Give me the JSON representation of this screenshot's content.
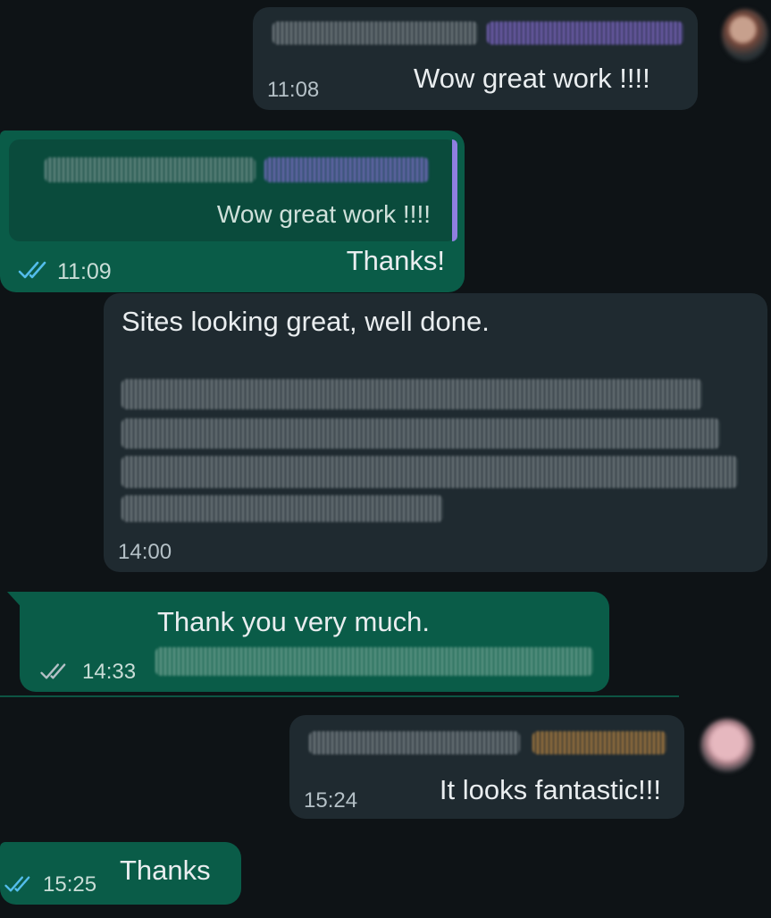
{
  "messages": [
    {
      "id": "m1",
      "direction": "incoming",
      "text": "Wow great work !!!!",
      "time": "11:08"
    },
    {
      "id": "m2",
      "direction": "outgoing",
      "quoted_text": "Wow great work !!!!",
      "text": "Thanks!",
      "time": "11:09",
      "status": "read"
    },
    {
      "id": "m3",
      "direction": "incoming",
      "text": "Sites looking great, well done.",
      "time": "14:00"
    },
    {
      "id": "m4",
      "direction": "outgoing",
      "text": "Thank you very much.",
      "time": "14:33",
      "status": "delivered"
    },
    {
      "id": "m5",
      "direction": "incoming",
      "text": "It looks fantastic!!!",
      "time": "15:24"
    },
    {
      "id": "m6",
      "direction": "outgoing",
      "text": "Thanks",
      "time": "15:25",
      "status": "read"
    }
  ],
  "icons": {
    "read_ticks": "double-check-blue-icon",
    "delivered_ticks": "double-check-grey-icon",
    "avatar": "avatar"
  },
  "colors": {
    "background": "#0e1316",
    "incoming_bubble": "#1f2a30",
    "outgoing_bubble": "#0a5c48",
    "read_tick": "#53bdeb",
    "delivered_tick": "#b4c0c6",
    "quote_bar": "#8f7fe0"
  }
}
